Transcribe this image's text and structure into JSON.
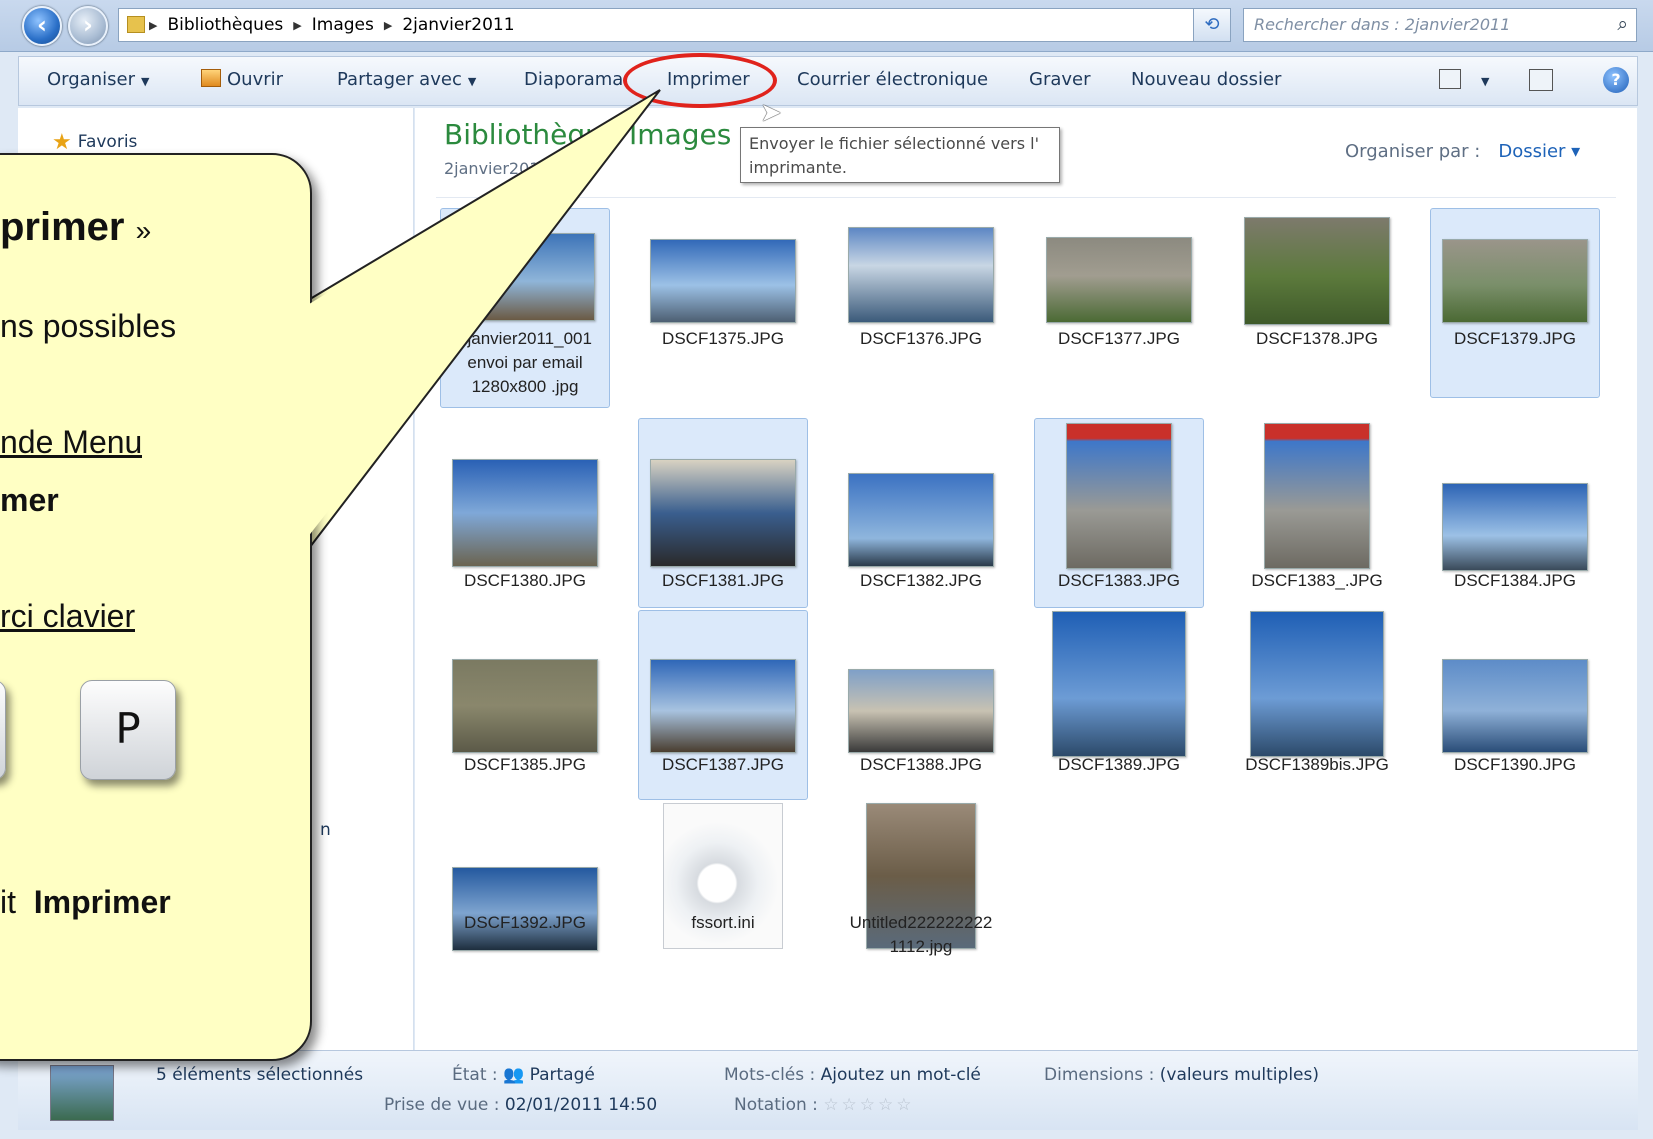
{
  "address": {
    "crumbs": [
      "Bibliothèques",
      "Images",
      "2janvier2011"
    ],
    "search_placeholder": "Rechercher dans : 2janvier2011"
  },
  "toolbar": {
    "organize": "Organiser",
    "open": "Ouvrir",
    "share": "Partager avec",
    "slideshow": "Diaporama",
    "print": "Imprimer",
    "email": "Courrier électronique",
    "burn": "Graver",
    "new_folder": "Nouveau dossier"
  },
  "tooltip": "Envoyer le fichier sélectionné vers l' imprimante.",
  "sidebar": {
    "favorites": "Favoris",
    "truncated": "n"
  },
  "library": {
    "title": "Bibliothèque Images",
    "subtitle": "2janvier2011",
    "arrange_label": "Organiser par :",
    "arrange_value": "Dossier"
  },
  "files": [
    {
      "name": "2janvier2011_001 envoi par email 1280x800 .jpg",
      "selected": true
    },
    {
      "name": "DSCF1375.JPG",
      "selected": false
    },
    {
      "name": "DSCF1376.JPG",
      "selected": false
    },
    {
      "name": "DSCF1377.JPG",
      "selected": false
    },
    {
      "name": "DSCF1378.JPG",
      "selected": false
    },
    {
      "name": "DSCF1379.JPG",
      "selected": true
    },
    {
      "name": "DSCF1380.JPG",
      "selected": false
    },
    {
      "name": "DSCF1381.JPG",
      "selected": true
    },
    {
      "name": "DSCF1382.JPG",
      "selected": false
    },
    {
      "name": "DSCF1383.JPG",
      "selected": true
    },
    {
      "name": "DSCF1383_.JPG",
      "selected": false
    },
    {
      "name": "DSCF1384.JPG",
      "selected": false
    },
    {
      "name": "DSCF1385.JPG",
      "selected": false
    },
    {
      "name": "DSCF1387.JPG",
      "selected": true
    },
    {
      "name": "DSCF1388.JPG",
      "selected": false
    },
    {
      "name": "DSCF1389.JPG",
      "selected": false
    },
    {
      "name": "DSCF1389bis.JPG",
      "selected": false
    },
    {
      "name": "DSCF1390.JPG",
      "selected": false
    },
    {
      "name": "DSCF1392.JPG",
      "selected": false
    },
    {
      "name": "fssort.ini",
      "selected": false
    },
    {
      "name": "Untitled2222222221112.jpg",
      "selected": false
    }
  ],
  "status": {
    "selected": "5 éléments sélectionnés",
    "state_label": "État :",
    "state_value": "Partagé",
    "taken_label": "Prise de vue :",
    "taken_value": "02/01/2011 14:50",
    "keywords_label": "Mots-clés :",
    "keywords_value": "Ajoutez un mot-clé",
    "rating_label": "Notation :",
    "rating_stars": "☆☆☆☆☆",
    "dimensions_label": "Dimensions :",
    "dimensions_value": "(valeurs multiples)"
  },
  "callout": {
    "heading": "primer",
    "heading_quote": "»",
    "line1": "ns possibles",
    "line2": "nde Menu",
    "line3": "mer",
    "line4": "rci   clavier",
    "key": "P",
    "line5": "it",
    "line5b": "Imprimer"
  },
  "colors": {
    "accent_ring": "#e0231c",
    "callout_bg": "#ffffc4",
    "library_title": "#2b8a3e",
    "selection": "#dbe9fa"
  }
}
